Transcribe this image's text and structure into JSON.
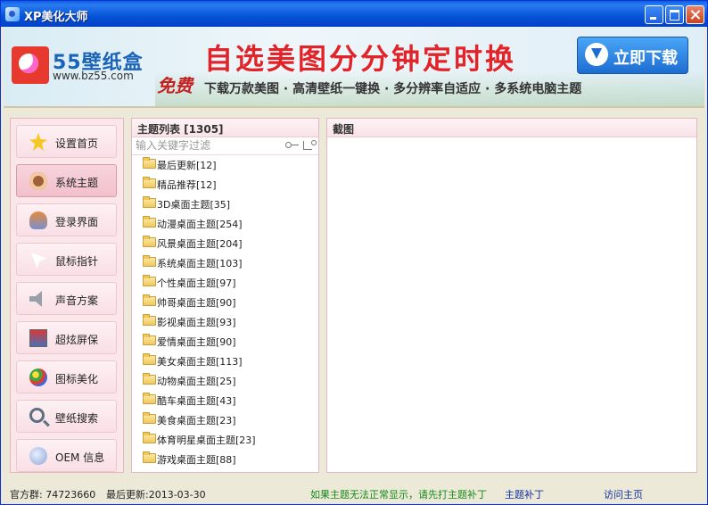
{
  "window": {
    "title": "XP美化大师"
  },
  "banner": {
    "logo_name": "55壁纸盒",
    "logo_url": "www.bz55.com",
    "headline": "自选美图分分钟定时换",
    "download_label": "立即下载",
    "free_label": "免费",
    "slogan": "下载万款美图 · 高清壁纸一键换 · 多分辨率自适应 · 多系统电脑主题"
  },
  "nav": {
    "items": [
      {
        "label": "设置首页",
        "icon": "star-icon"
      },
      {
        "label": "系统主题",
        "icon": "monkey-icon",
        "active": true
      },
      {
        "label": "登录界面",
        "icon": "users-icon"
      },
      {
        "label": "鼠标指针",
        "icon": "cursor-icon"
      },
      {
        "label": "声音方案",
        "icon": "speaker-icon"
      },
      {
        "label": "超炫屏保",
        "icon": "screensaver-icon"
      },
      {
        "label": "图标美化",
        "icon": "palette-icon"
      },
      {
        "label": "壁纸搜索",
        "icon": "search-icon"
      },
      {
        "label": "OEM 信息",
        "icon": "globe-icon"
      }
    ]
  },
  "theme_list": {
    "title": "主题列表 [1305]",
    "filter_placeholder": "输入关键字过滤",
    "items": [
      "最后更新[12]",
      "精品推荐[12]",
      "3D桌面主题[35]",
      "动漫桌面主题[254]",
      "风景桌面主题[204]",
      "系统桌面主题[103]",
      "个性桌面主题[97]",
      "帅哥桌面主题[90]",
      "影视桌面主题[93]",
      "爱情桌面主题[90]",
      "美女桌面主题[113]",
      "动物桌面主题[25]",
      "酷车桌面主题[43]",
      "美食桌面主题[23]",
      "体育明星桌面主题[23]",
      "游戏桌面主题[88]"
    ]
  },
  "screenshot_panel": {
    "title": "截图"
  },
  "status": {
    "group": "官方群: 74723660",
    "last_update": "最后更新:2013-03-30",
    "notice": "如果主题无法正常显示，请先打主题补丁",
    "patch_link": "主题补丁",
    "home_link": "访问主页"
  }
}
